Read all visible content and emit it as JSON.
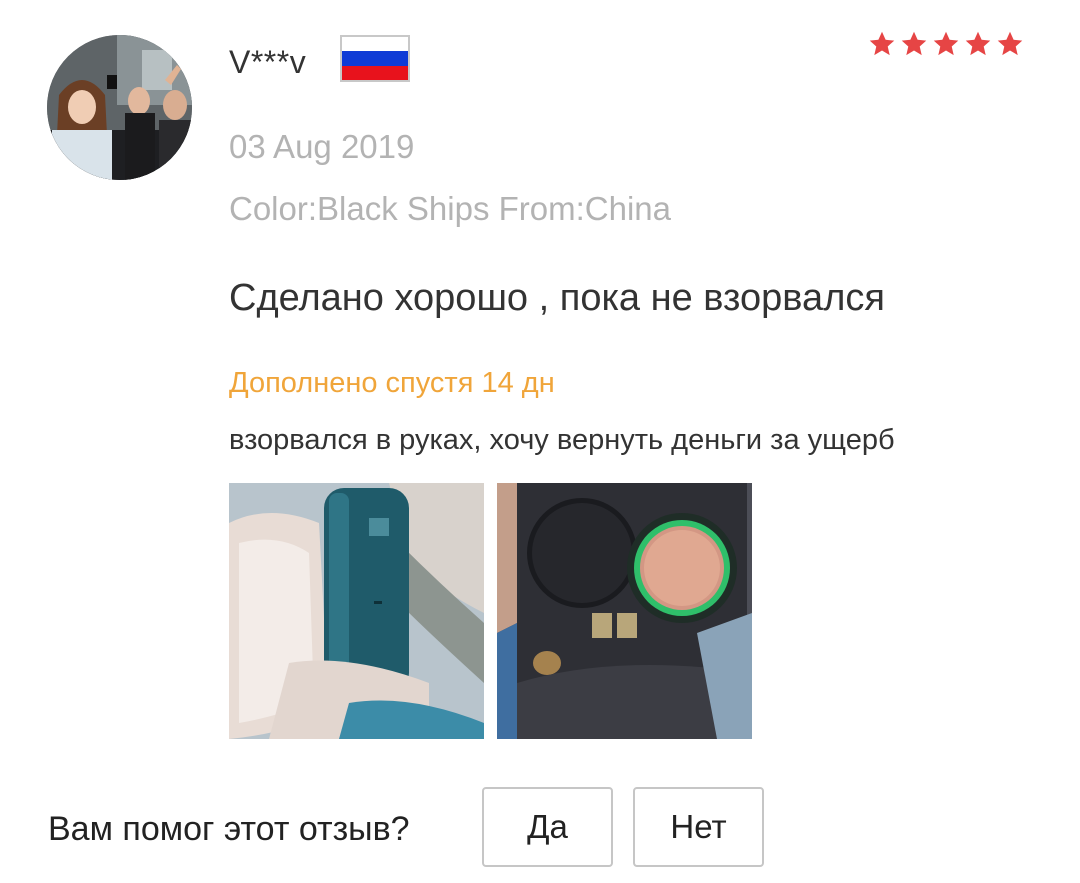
{
  "review": {
    "author": "V***v",
    "country_flag": "russia-flag-icon",
    "rating": 5,
    "rating_max": 5,
    "date": "03 Aug 2019",
    "options": "Color:Black Ships From:China",
    "text": "Сделано хорошо , пока не взорвался",
    "additional": {
      "label": "Дополнено спустя 14 дн",
      "text": "взорвался в руках, хочу вернуть деньги за ущерб"
    },
    "photos": [
      "review-photo-device-in-hand",
      "review-photo-burnt-device-interior"
    ]
  },
  "helpful": {
    "question": "Вам помог этот отзыв?",
    "yes_label": "Да",
    "no_label": "Нет"
  },
  "colors": {
    "star": "#e64545",
    "additional_label": "#f0a53a",
    "meta_text": "#b3b3b3",
    "flag_white": "#ffffff",
    "flag_blue": "#0f3bd6",
    "flag_red": "#e8121c"
  }
}
